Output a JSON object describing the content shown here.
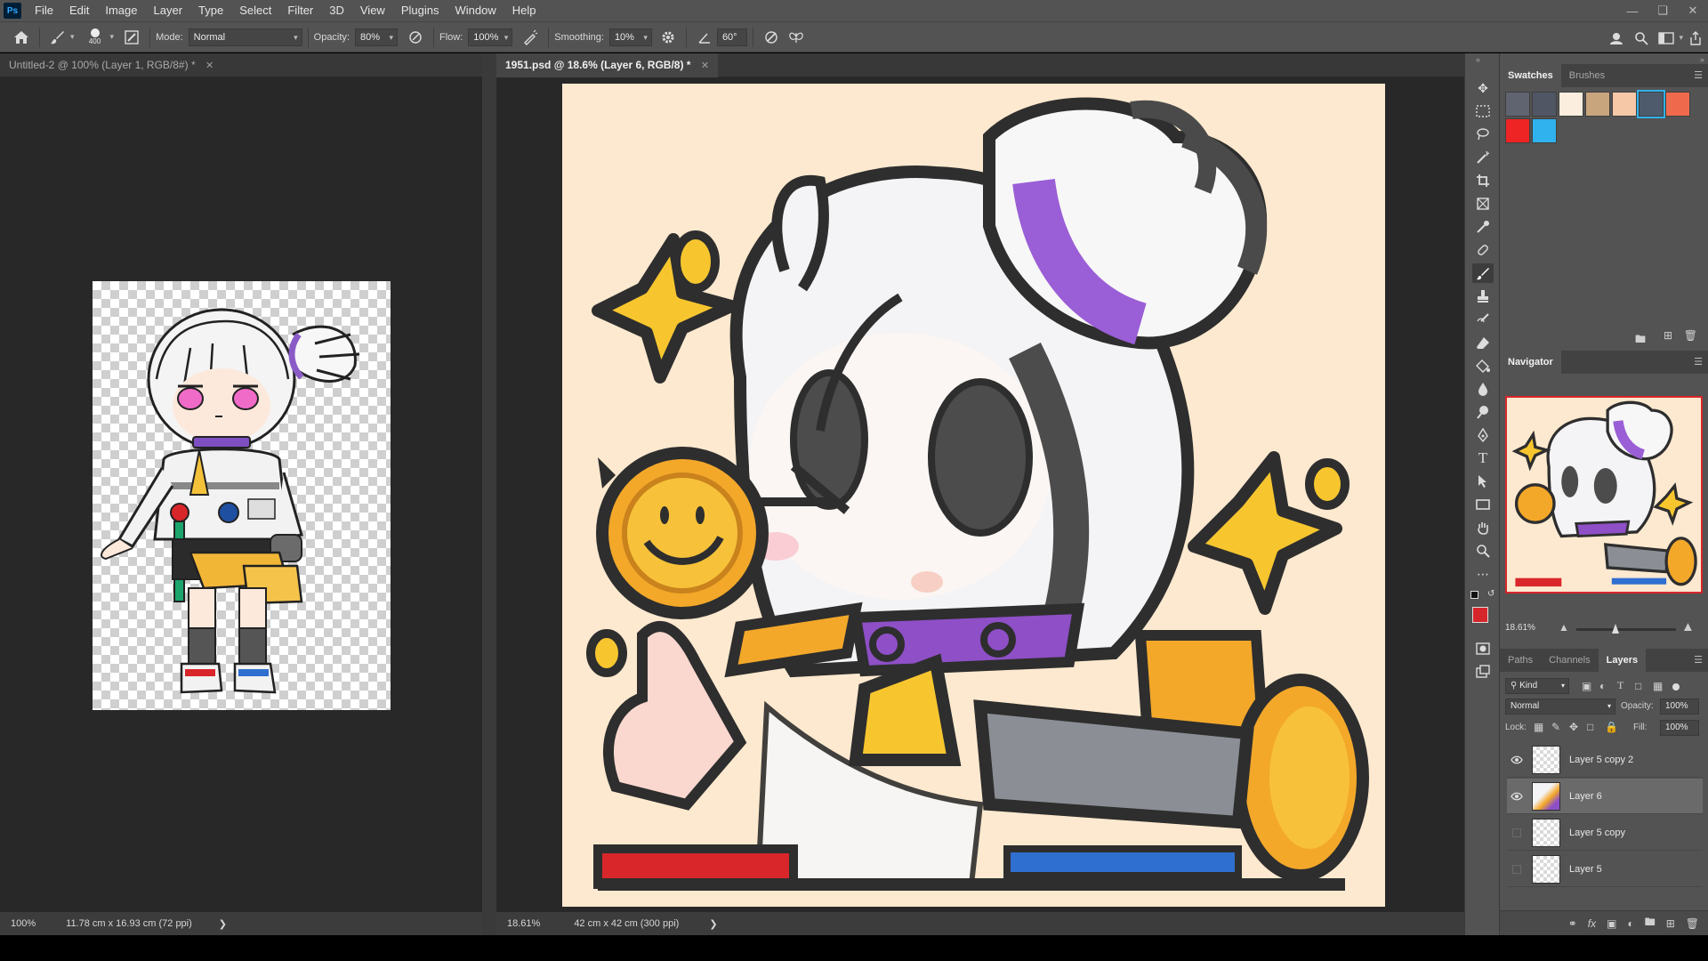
{
  "menubar": {
    "logo": "Ps",
    "items": [
      "File",
      "Edit",
      "Image",
      "Layer",
      "Type",
      "Select",
      "Filter",
      "3D",
      "View",
      "Plugins",
      "Window",
      "Help"
    ]
  },
  "options": {
    "brush_size": "400",
    "mode_label": "Mode:",
    "mode_value": "Normal",
    "opacity_label": "Opacity:",
    "opacity_value": "80%",
    "flow_label": "Flow:",
    "flow_value": "100%",
    "smoothing_label": "Smoothing:",
    "smoothing_value": "10%",
    "angle_value": "60°"
  },
  "documents": {
    "left": {
      "tab_title": "Untitled-2 @ 100% (Layer 1, RGB/8#) *",
      "zoom": "100%",
      "size": "11.78 cm x 16.93 cm (72 ppi)"
    },
    "right": {
      "tab_title": "1951.psd @ 18.6% (Layer 6, RGB/8) *",
      "zoom": "18.61%",
      "size": "42 cm x 42 cm (300 ppi)"
    }
  },
  "panels": {
    "top_tabs": [
      "Swatches",
      "Brushes"
    ],
    "swatches": [
      "#5f6470",
      "#505664",
      "#fbeede",
      "#c9a57e",
      "#f6c8a8",
      "#4e5b6c",
      "#ef6a4d",
      "#ee2424",
      "#2fb2ee"
    ],
    "navigator_title": "Navigator",
    "navigator_zoom": "18.61%",
    "layer_tabs": [
      "Paths",
      "Channels",
      "Layers"
    ],
    "filter_kind": "Kind",
    "blend_mode": "Normal",
    "opacity_label": "Opacity:",
    "opacity_value": "100%",
    "lock_label": "Lock:",
    "fill_label": "Fill:",
    "fill_value": "100%",
    "layers": [
      {
        "name": "Layer 5 copy 2",
        "visible": true,
        "selected": false
      },
      {
        "name": "Layer 6",
        "visible": true,
        "selected": true
      },
      {
        "name": "Layer 5 copy",
        "visible": false,
        "selected": false
      },
      {
        "name": "Layer 5",
        "visible": false,
        "selected": false
      }
    ]
  },
  "colors": {
    "foreground": "#d7262b",
    "background": "#111111",
    "canvas_bg": "#fde9cf"
  }
}
